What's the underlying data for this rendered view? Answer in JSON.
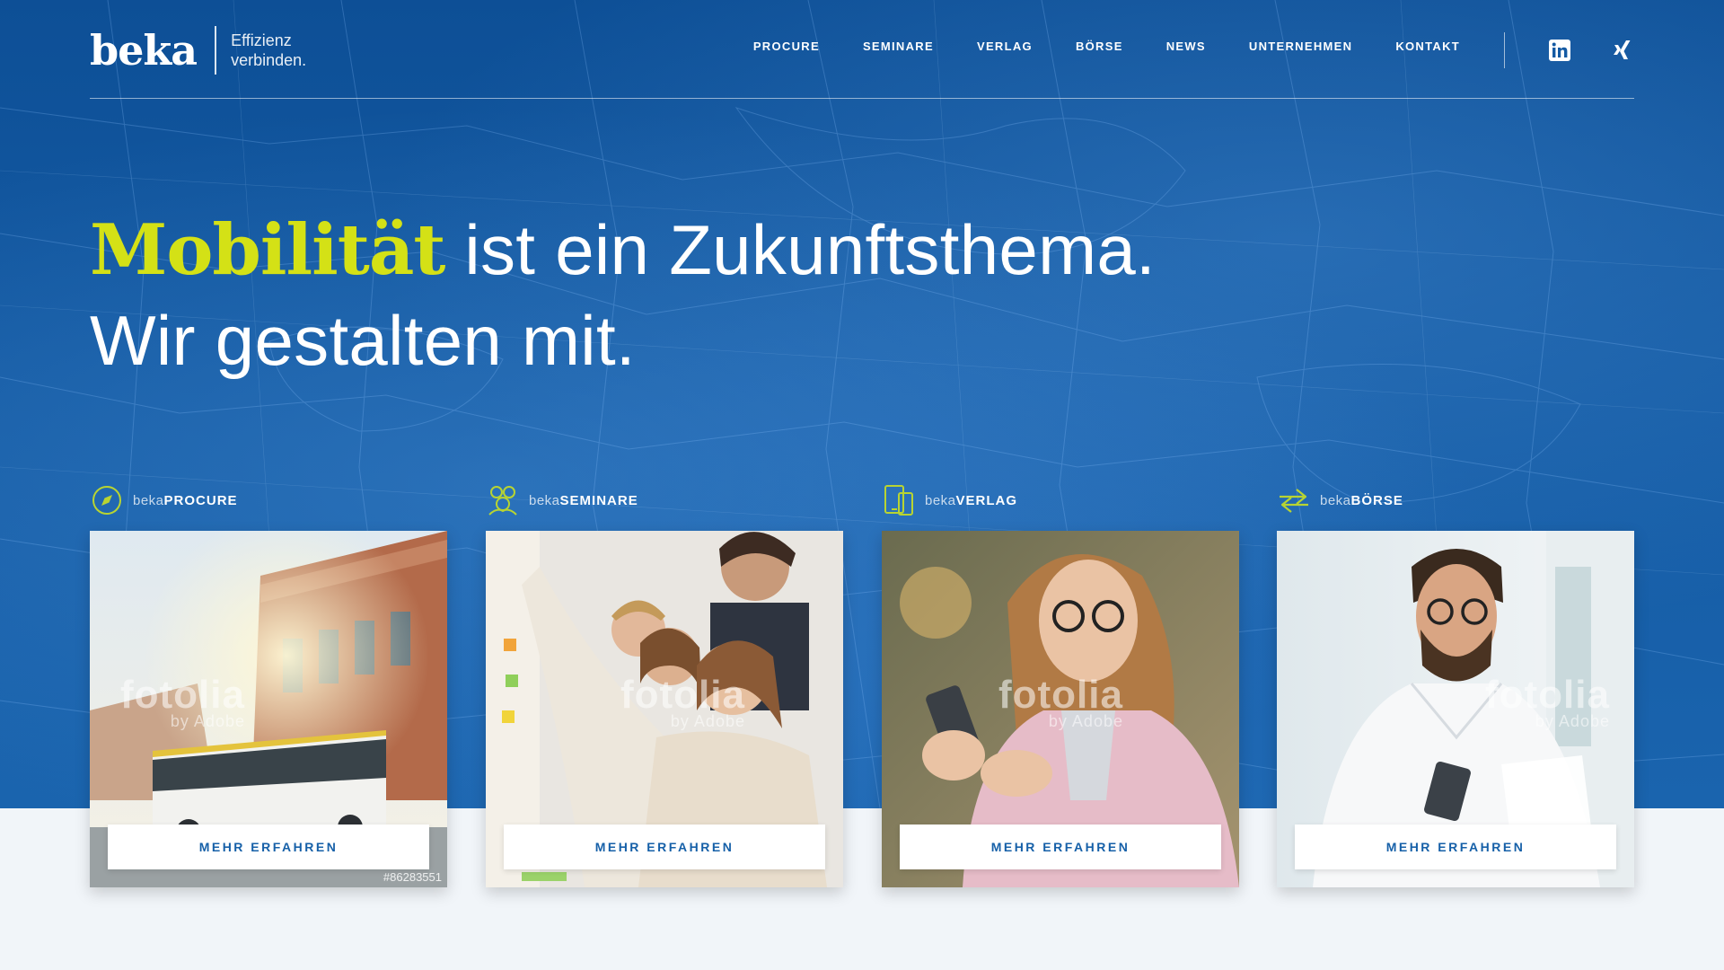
{
  "brand": {
    "logo_text": "beka",
    "tagline_line1": "Effizienz",
    "tagline_line2": "verbinden.",
    "accent_color": "#d4e116",
    "primary_color": "#145aa3"
  },
  "nav": {
    "items": [
      {
        "label": "PROCURE"
      },
      {
        "label": "SEMINARE"
      },
      {
        "label": "VERLAG"
      },
      {
        "label": "BÖRSE"
      },
      {
        "label": "NEWS"
      },
      {
        "label": "UNTERNEHMEN"
      },
      {
        "label": "KONTAKT"
      }
    ],
    "social": [
      {
        "icon": "linkedin-icon"
      },
      {
        "icon": "xing-icon"
      }
    ]
  },
  "hero": {
    "headline_accent": "Mobilität",
    "headline_rest": " ist ein Zukunftsthema.",
    "headline_line2": "Wir gestalten mit."
  },
  "cards": [
    {
      "prefix": "beka",
      "name": "PROCURE",
      "icon": "compass-icon",
      "button": "MEHR ERFAHREN",
      "watermark": "fotolia",
      "watermark_sub": "by Adobe",
      "stock_id": "#86283551"
    },
    {
      "prefix": "beka",
      "name": "SEMINARE",
      "icon": "people-icon",
      "button": "MEHR ERFAHREN",
      "watermark": "fotolia",
      "watermark_sub": "by Adobe"
    },
    {
      "prefix": "beka",
      "name": "VERLAG",
      "icon": "devices-icon",
      "button": "MEHR ERFAHREN",
      "watermark": "fotolia",
      "watermark_sub": "by Adobe"
    },
    {
      "prefix": "beka",
      "name": "BÖRSE",
      "icon": "exchange-arrows-icon",
      "button": "MEHR ERFAHREN",
      "watermark": "fotolia",
      "watermark_sub": "by Adobe"
    }
  ]
}
